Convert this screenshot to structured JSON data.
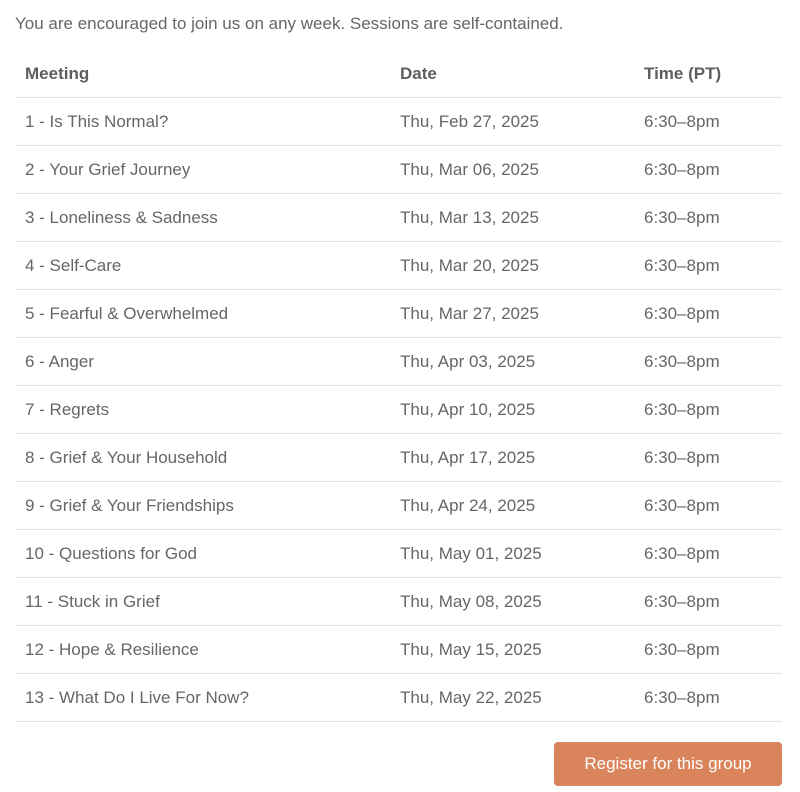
{
  "intro": "You are encouraged to join us on any week. Sessions are self-contained.",
  "table": {
    "headers": {
      "meeting": "Meeting",
      "date": "Date",
      "time": "Time (PT)"
    },
    "rows": [
      {
        "meeting": "1 - Is This Normal?",
        "date": "Thu, Feb 27, 2025",
        "time": "6:30–8pm"
      },
      {
        "meeting": "2 - Your Grief Journey",
        "date": "Thu, Mar 06, 2025",
        "time": "6:30–8pm"
      },
      {
        "meeting": "3 - Loneliness & Sadness",
        "date": "Thu, Mar 13, 2025",
        "time": "6:30–8pm"
      },
      {
        "meeting": "4 - Self-Care",
        "date": "Thu, Mar 20, 2025",
        "time": "6:30–8pm"
      },
      {
        "meeting": "5 - Fearful & Overwhelmed",
        "date": "Thu, Mar 27, 2025",
        "time": "6:30–8pm"
      },
      {
        "meeting": "6 - Anger",
        "date": "Thu, Apr 03, 2025",
        "time": "6:30–8pm"
      },
      {
        "meeting": "7 - Regrets",
        "date": "Thu, Apr 10, 2025",
        "time": "6:30–8pm"
      },
      {
        "meeting": "8 - Grief & Your Household",
        "date": "Thu, Apr 17, 2025",
        "time": "6:30–8pm"
      },
      {
        "meeting": "9 - Grief & Your Friendships",
        "date": "Thu, Apr 24, 2025",
        "time": "6:30–8pm"
      },
      {
        "meeting": "10 - Questions for God",
        "date": "Thu, May 01, 2025",
        "time": "6:30–8pm"
      },
      {
        "meeting": "11 - Stuck in Grief",
        "date": "Thu, May 08, 2025",
        "time": "6:30–8pm"
      },
      {
        "meeting": "12 - Hope & Resilience",
        "date": "Thu, May 15, 2025",
        "time": "6:30–8pm"
      },
      {
        "meeting": "13 - What Do I Live For Now?",
        "date": "Thu, May 22, 2025",
        "time": "6:30–8pm"
      }
    ]
  },
  "register_button": {
    "label": "Register for this group",
    "color": "#d9845a"
  }
}
